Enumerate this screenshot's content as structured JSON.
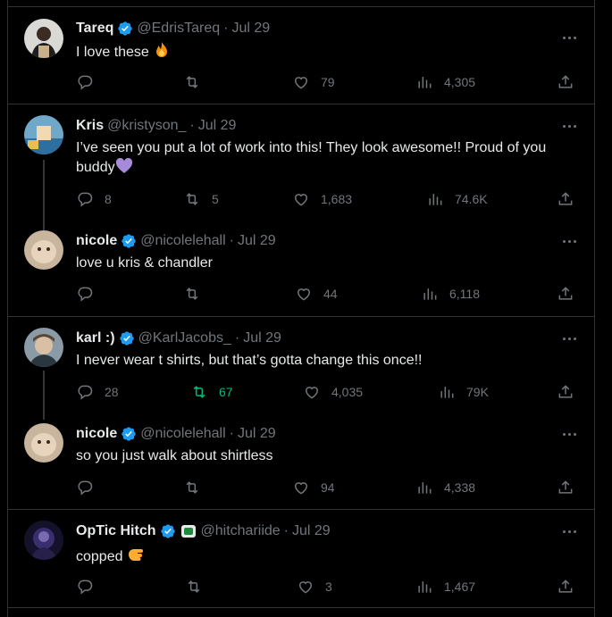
{
  "tweets": [
    {
      "name": "Tareq",
      "verified": true,
      "handle": "@EdrisTareq",
      "date": "Jul 29",
      "text": "I love these",
      "emoji": "fire",
      "replies": "",
      "retweets": "",
      "likes": "79",
      "views": "4,305"
    },
    {
      "name": "Kris",
      "verified": false,
      "handle": "@kristyson_",
      "date": "Jul 29",
      "text": "I’ve seen you put a lot of work into this! They look awesome!! Proud of you buddy",
      "emoji": "purple-heart",
      "replies": "8",
      "retweets": "5",
      "likes": "1,683",
      "views": "74.6K"
    },
    {
      "name": "nicole",
      "verified": true,
      "handle": "@nicolelehall",
      "date": "Jul 29",
      "text": "love u kris & chandler",
      "replies": "",
      "retweets": "",
      "likes": "44",
      "views": "6,118"
    },
    {
      "name": "karl :)",
      "verified": true,
      "handle": "@KarlJacobs_",
      "date": "Jul 29",
      "text": "I never wear t shirts, but that’s gotta change this once!!",
      "replies": "28",
      "retweets": "67",
      "retweeted": true,
      "likes": "4,035",
      "views": "79K"
    },
    {
      "name": "nicole",
      "verified": true,
      "handle": "@nicolelehall",
      "date": "Jul 29",
      "text": "so you just walk about shirtless",
      "replies": "",
      "retweets": "",
      "likes": "94",
      "views": "4,338"
    },
    {
      "name": "OpTic Hitch",
      "verified": true,
      "affiliate_badge": true,
      "handle": "@hitchariide",
      "date": "Jul 29",
      "text": "copped",
      "emoji": "pointing-hand",
      "replies": "",
      "retweets": "",
      "likes": "3",
      "views": "1,467"
    }
  ],
  "colors": {
    "background": "#000000",
    "border": "#2f3336",
    "text": "#e7e9ea",
    "muted": "#71767b",
    "verified": "#1d9bf0",
    "retweet_active": "#00ba7c"
  },
  "icons": {
    "reply": "reply-icon",
    "retweet": "retweet-icon",
    "like": "heart-icon",
    "views": "views-icon",
    "share": "share-icon",
    "more": "more-icon",
    "verified": "verified-badge-icon"
  }
}
